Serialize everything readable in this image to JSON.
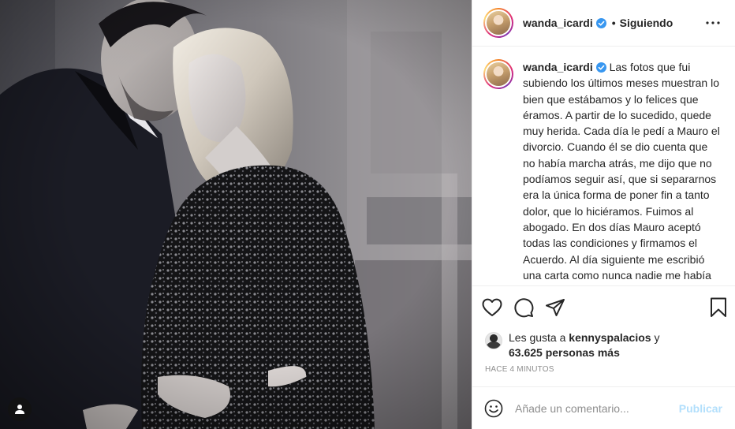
{
  "post": {
    "photo_alt_subject": "couple-photo",
    "user_tag_icon": "person-icon"
  },
  "header": {
    "username": "wanda_icardi",
    "separator": "•",
    "follow_state": "Siguiendo",
    "more_icon": "ellipsis-icon"
  },
  "caption": {
    "username": "wanda_icardi",
    "text": "Las fotos que fui subiendo los últimos meses muestran lo bien que estábamos y lo felices que éramos. A partir de lo sucedido, quede muy herida. Cada día le pedí a Mauro el divorcio. Cuando él se dio cuenta que no había marcha atrás, me dijo que no podíamos seguir así, que si separarnos era la única forma de poner fin a tanto dolor, que lo hiciéramos. Fuimos al abogado. En dos días Mauro aceptó todas las condiciones y firmamos el Acuerdo. Al día siguiente me escribió una carta como nunca nadie me había escrito jamás: “Te di todo y tenes todo, ni él ni nadie te hará tan feliz como yo”"
  },
  "actions": {
    "like_icon": "heart-icon",
    "comment_icon": "comment-icon",
    "share_icon": "paper-plane-icon",
    "save_icon": "bookmark-icon"
  },
  "likes": {
    "prefix": "Les gusta a",
    "liker": "kennyspalacios",
    "joiner": "y",
    "count_text": "63.625 personas más"
  },
  "timestamp": "Hace 4 minutos",
  "comment": {
    "emoji_icon": "smiley-icon",
    "placeholder": "Añade un comentario...",
    "publish_label": "Publicar"
  },
  "colors": {
    "verified": "#3897f0",
    "publish_disabled": "#b2dffc",
    "border": "#efefef",
    "secondary_text": "#8e8e8e"
  }
}
